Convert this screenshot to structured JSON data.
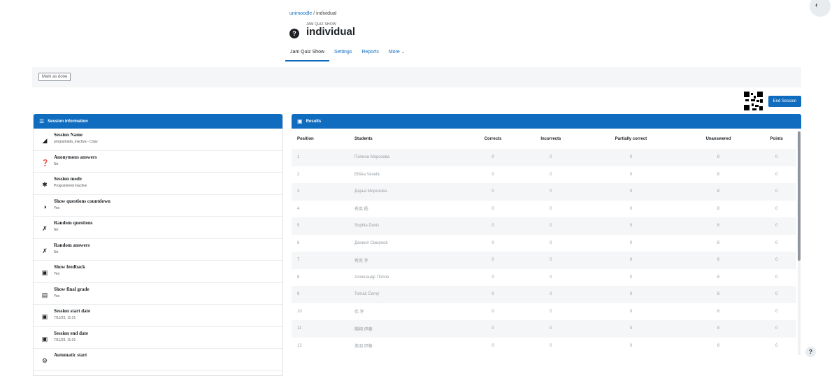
{
  "breadcrumb": {
    "course": "unimoodle",
    "separator": "/",
    "current": "individual"
  },
  "header": {
    "kicker": "JAM QUIZ SHOW",
    "title": "individual",
    "icon": "question-circle-icon"
  },
  "tabs": [
    {
      "label": "Jam Quiz Show",
      "active": true
    },
    {
      "label": "Settings",
      "active": false
    },
    {
      "label": "Reports",
      "active": false
    },
    {
      "label": "More",
      "active": false
    }
  ],
  "completion": {
    "mark_done_label": "Mark as done"
  },
  "actions": {
    "end_session_label": "End Session"
  },
  "session_panel": {
    "title": "Session information",
    "rows": [
      {
        "icon": "tag-icon",
        "title": "Session Name",
        "value": "programada_inactiva - Copy"
      },
      {
        "icon": "question-circle-icon",
        "title": "Anonymous answers",
        "value": "No"
      },
      {
        "icon": "puzzle-icon",
        "title": "Session mode",
        "value": "Programmed inactive"
      },
      {
        "icon": "timer-icon",
        "title": "Show questions countdown",
        "value": "Yes"
      },
      {
        "icon": "shuffle-icon",
        "title": "Random questions",
        "value": "No"
      },
      {
        "icon": "shuffle-icon",
        "title": "Random answers",
        "value": "No"
      },
      {
        "icon": "feedback-icon",
        "title": "Show feedback",
        "value": "Yes"
      },
      {
        "icon": "grade-icon",
        "title": "Show final grade",
        "value": "Yes"
      },
      {
        "icon": "calendar-icon",
        "title": "Session start date",
        "value": "7/11/23, 11:31"
      },
      {
        "icon": "calendar-icon",
        "title": "Session end date",
        "value": "7/11/23, 11:31"
      },
      {
        "icon": "gear-icon",
        "title": "Automatic start",
        "value": ""
      }
    ]
  },
  "results_panel": {
    "title": "Results",
    "columns": [
      "Position",
      "Students",
      "Corrects",
      "Incorrects",
      "Partially correct",
      "Unanswered",
      "Points"
    ],
    "rows": [
      [
        "1",
        "Полина Морозова",
        "0",
        "0",
        "0",
        "8",
        "0"
      ],
      [
        "2",
        "Eliška Veselá",
        "0",
        "0",
        "0",
        "8",
        "0"
      ],
      [
        "3",
        "Дарья Морозова",
        "0",
        "0",
        "0",
        "8",
        "0"
      ],
      [
        "4",
        "秀英 杨",
        "0",
        "0",
        "0",
        "8",
        "0"
      ],
      [
        "5",
        "Sophia Davis",
        "0",
        "0",
        "0",
        "8",
        "0"
      ],
      [
        "6",
        "Даниил Смирнов",
        "0",
        "0",
        "0",
        "8",
        "0"
      ],
      [
        "7",
        "秀英 李",
        "0",
        "0",
        "0",
        "8",
        "0"
      ],
      [
        "8",
        "Александр Попов",
        "0",
        "0",
        "0",
        "8",
        "0"
      ],
      [
        "9",
        "Tomáš Černý",
        "0",
        "0",
        "0",
        "8",
        "0"
      ],
      [
        "10",
        "伟 李",
        "0",
        "0",
        "0",
        "8",
        "0"
      ],
      [
        "11",
        "陽翔 伊藤",
        "0",
        "0",
        "0",
        "8",
        "0"
      ],
      [
        "12",
        "美羽 伊藤",
        "0",
        "0",
        "0",
        "8",
        "0"
      ]
    ]
  },
  "colors": {
    "accent": "#0f6cbf",
    "muted_text": "#9aa0a6",
    "stripe": "#f5f6f7"
  }
}
